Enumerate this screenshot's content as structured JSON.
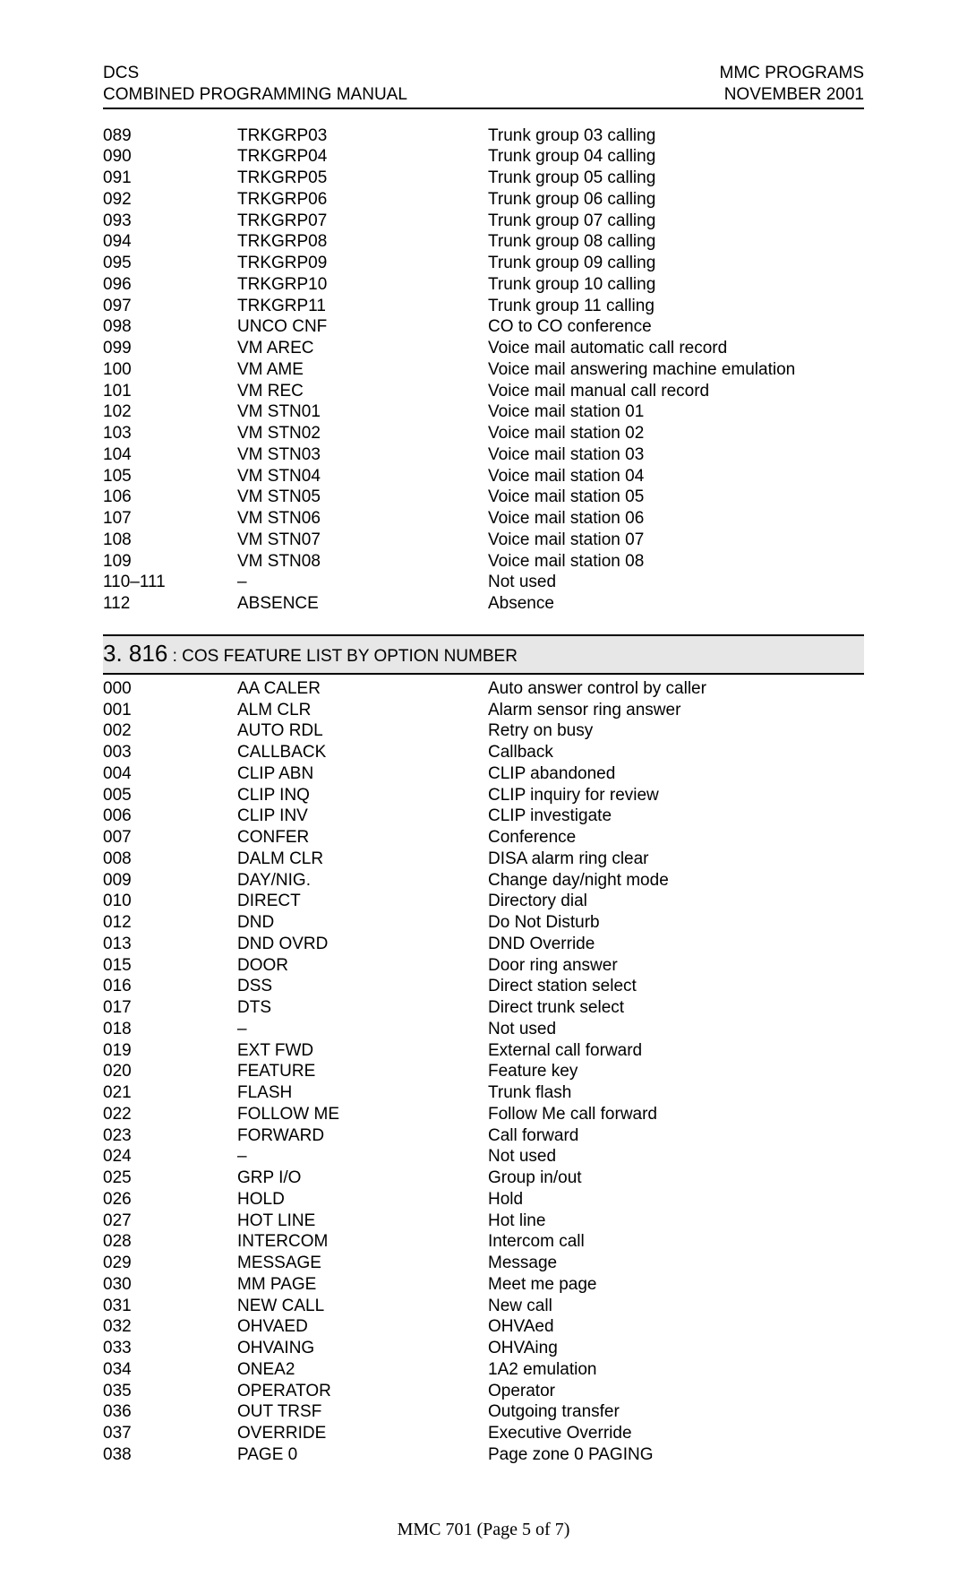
{
  "header": {
    "left1": "DCS",
    "left2": "COMBINED PROGRAMMING MANUAL",
    "right1": "MMC PROGRAMS",
    "right2": "NOVEMBER 2001"
  },
  "table1": {
    "rows": [
      {
        "n": "089",
        "c": "TRKGRP03",
        "d": "Trunk group 03 calling"
      },
      {
        "n": "090",
        "c": "TRKGRP04",
        "d": "Trunk group 04 calling"
      },
      {
        "n": "091",
        "c": "TRKGRP05",
        "d": "Trunk group 05 calling"
      },
      {
        "n": "092",
        "c": "TRKGRP06",
        "d": "Trunk group 06 calling"
      },
      {
        "n": "093",
        "c": "TRKGRP07",
        "d": "Trunk group 07 calling"
      },
      {
        "n": "094",
        "c": "TRKGRP08",
        "d": "Trunk group 08 calling"
      },
      {
        "n": "095",
        "c": "TRKGRP09",
        "d": "Trunk group 09 calling"
      },
      {
        "n": "096",
        "c": "TRKGRP10",
        "d": "Trunk group 10 calling"
      },
      {
        "n": "097",
        "c": "TRKGRP11",
        "d": "Trunk group 11 calling"
      },
      {
        "n": "098",
        "c": "UNCO CNF",
        "d": "CO to CO conference"
      },
      {
        "n": "099",
        "c": "VM AREC",
        "d": "Voice mail automatic call record"
      },
      {
        "n": "100",
        "c": "VM AME",
        "d": "Voice mail answering machine emulation"
      },
      {
        "n": "101",
        "c": "VM REC",
        "d": "Voice mail manual call record"
      },
      {
        "n": "102",
        "c": "VM STN01",
        "d": "Voice mail station 01"
      },
      {
        "n": "103",
        "c": "VM STN02",
        "d": "Voice mail station 02"
      },
      {
        "n": "104",
        "c": "VM STN03",
        "d": "Voice mail station 03"
      },
      {
        "n": "105",
        "c": "VM STN04",
        "d": "Voice mail station 04"
      },
      {
        "n": "106",
        "c": "VM STN05",
        "d": "Voice mail station 05"
      },
      {
        "n": "107",
        "c": "VM STN06",
        "d": "Voice mail station 06"
      },
      {
        "n": "108",
        "c": "VM STN07",
        "d": "Voice mail station 07"
      },
      {
        "n": "109",
        "c": "VM STN08",
        "d": "Voice mail station 08"
      },
      {
        "n": "110–111",
        "c": "–",
        "d": "Not used"
      },
      {
        "n": "112",
        "c": "ABSENCE",
        "d": "Absence"
      }
    ]
  },
  "section": {
    "big": "3. 816",
    "small": " : COS FEATURE LIST BY OPTION NUMBER"
  },
  "table2": {
    "rows": [
      {
        "n": "000",
        "c": "AA CALER",
        "d": "Auto answer control by caller"
      },
      {
        "n": "001",
        "c": "ALM CLR",
        "d": "Alarm sensor ring answer"
      },
      {
        "n": "002",
        "c": "AUTO RDL",
        "d": "Retry on busy"
      },
      {
        "n": "003",
        "c": "CALLBACK",
        "d": "Callback"
      },
      {
        "n": "004",
        "c": "CLIP ABN",
        "d": "CLIP abandoned"
      },
      {
        "n": "005",
        "c": "CLIP INQ",
        "d": "CLIP inquiry for review"
      },
      {
        "n": "006",
        "c": "CLIP INV",
        "d": "CLIP investigate"
      },
      {
        "n": "007",
        "c": "CONFER",
        "d": "Conference"
      },
      {
        "n": "008",
        "c": "DALM CLR",
        "d": "DISA alarm ring clear"
      },
      {
        "n": "009",
        "c": "DAY/NIG.",
        "d": "Change day/night mode"
      },
      {
        "n": "010",
        "c": "DIRECT",
        "d": "Directory dial"
      },
      {
        "n": "012",
        "c": "DND",
        "d": "Do Not Disturb"
      },
      {
        "n": "013",
        "c": "DND OVRD",
        "d": "DND Override"
      },
      {
        "n": "015",
        "c": "DOOR",
        "d": "Door ring answer"
      },
      {
        "n": "016",
        "c": "DSS",
        "d": "Direct station select"
      },
      {
        "n": "017",
        "c": "DTS",
        "d": "Direct trunk select"
      },
      {
        "n": "018",
        "c": "–",
        "d": "Not used"
      },
      {
        "n": "019",
        "c": "EXT FWD",
        "d": "External call forward"
      },
      {
        "n": "020",
        "c": "FEATURE",
        "d": "Feature key"
      },
      {
        "n": "021",
        "c": "FLASH",
        "d": "Trunk flash"
      },
      {
        "n": "022",
        "c": "FOLLOW ME",
        "d": "Follow Me call forward"
      },
      {
        "n": "023",
        "c": "FORWARD",
        "d": "Call forward"
      },
      {
        "n": "024",
        "c": "–",
        "d": "Not used"
      },
      {
        "n": "025",
        "c": "GRP I/O",
        "d": "Group in/out"
      },
      {
        "n": "026",
        "c": "HOLD",
        "d": "Hold"
      },
      {
        "n": "027",
        "c": "HOT LINE",
        "d": "Hot line"
      },
      {
        "n": "028",
        "c": "INTERCOM",
        "d": "Intercom call"
      },
      {
        "n": "029",
        "c": "MESSAGE",
        "d": "Message"
      },
      {
        "n": "030",
        "c": "MM PAGE",
        "d": "Meet me page"
      },
      {
        "n": "031",
        "c": "NEW CALL",
        "d": "New call"
      },
      {
        "n": "032",
        "c": "OHVAED",
        "d": "OHVAed"
      },
      {
        "n": "033",
        "c": "OHVAING",
        "d": "OHVAing"
      },
      {
        "n": "034",
        "c": "ONEA2",
        "d": "1A2 emulation"
      },
      {
        "n": "035",
        "c": "OPERATOR",
        "d": "Operator"
      },
      {
        "n": "036",
        "c": "OUT TRSF",
        "d": "Outgoing transfer"
      },
      {
        "n": "037",
        "c": "OVERRIDE",
        "d": "Executive Override"
      },
      {
        "n": "038",
        "c": "PAGE 0",
        "d": "Page zone 0 PAGING"
      }
    ]
  },
  "footer": "MMC 701 (Page 5 of 7)"
}
